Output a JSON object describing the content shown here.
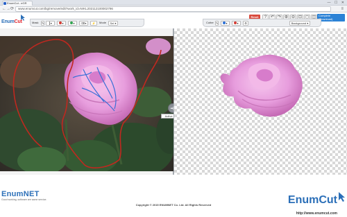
{
  "browser": {
    "tab_title": "EnumCut - eGR",
    "window_controls": "— ☐ ✕",
    "url": "www.enumcut.com/bg/remove/edit?work_id=NrKL202112100002796",
    "back_glyph": "←",
    "forward_glyph": "→",
    "reload_glyph": "⟳",
    "menu_glyph": "≡"
  },
  "app": {
    "logo_text_a": "Enum",
    "logo_text_b": "Cut",
    "reset_label": "Reset",
    "complete_label_1": "Complete",
    "complete_label_2": "(Download)",
    "tools": [
      {
        "name": "help-icon",
        "glyph": "?"
      },
      {
        "name": "undo-icon",
        "glyph": "↶"
      },
      {
        "name": "redo-icon",
        "glyph": "↷"
      },
      {
        "name": "zoom-in-icon",
        "glyph": "⊕"
      },
      {
        "name": "zoom-out-icon",
        "glyph": "⊖"
      },
      {
        "name": "fit-icon",
        "glyph": "⊡"
      },
      {
        "name": "original-size-icon",
        "glyph": "◻"
      },
      {
        "name": "compare-icon",
        "glyph": "◫"
      }
    ]
  },
  "toolbar_left": {
    "mask_label": "Mask",
    "mode_label": "Mode",
    "mode_value": "Sel ▾"
  },
  "toolbar_right": {
    "cutter_label": "Cutter",
    "background_label": "Background ▾"
  },
  "canvas": {
    "active_glyph": "➜",
    "active_label": "Active Click"
  },
  "footer": {
    "enumnet_name": "EnumNET",
    "enumnet_tag": "Good working, software are same service.",
    "copyright": "Copyright © 2015 ENUMNET Co. Ltd. All Rights Reserved",
    "enumcut_name": "EnumCut",
    "enumcut_url": "http://www.enumcut.com"
  },
  "colors": {
    "brand_blue": "#2b6fb8",
    "reset_red": "#d94a3d",
    "complete_blue": "#2b82d6",
    "mask_red": "#c0281f",
    "mask_blue": "#3b6fd6"
  }
}
